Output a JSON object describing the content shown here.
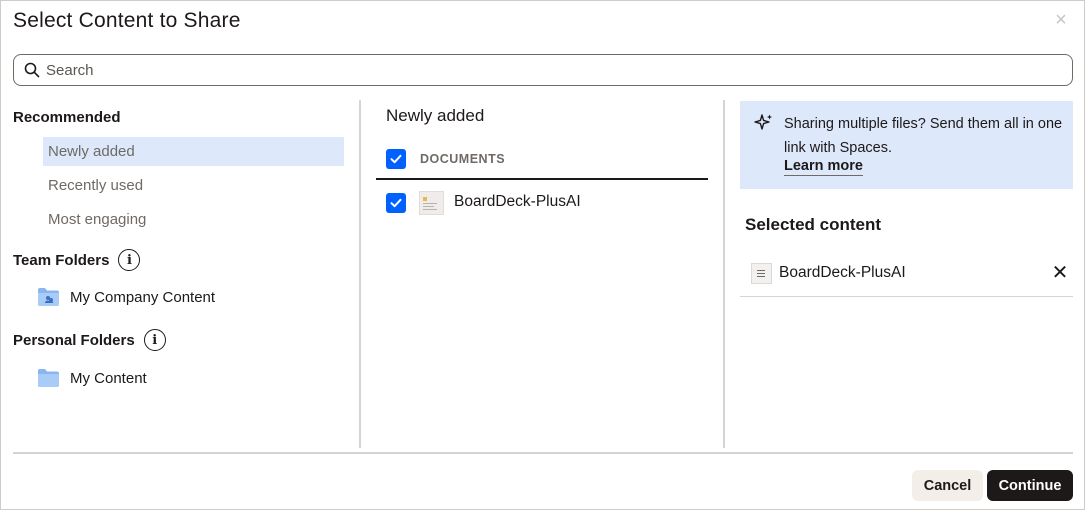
{
  "dialog": {
    "title": "Select Content to Share",
    "close_label": "×"
  },
  "search": {
    "placeholder": "Search"
  },
  "left": {
    "recommended_heading": "Recommended",
    "recommended_items": [
      {
        "label": "Newly added",
        "active": true
      },
      {
        "label": "Recently used",
        "active": false
      },
      {
        "label": "Most engaging",
        "active": false
      }
    ],
    "team_heading": "Team Folders",
    "team_folder": "My Company Content",
    "personal_heading": "Personal Folders",
    "personal_folder": "My Content",
    "info_glyph": "i"
  },
  "middle": {
    "title": "Newly added",
    "documents_heading": "DOCUMENTS",
    "items": [
      {
        "name": "BoardDeck-PlusAI",
        "checked": true
      }
    ]
  },
  "right": {
    "banner_text": "Sharing multiple files? Send them all in one link with Spaces.",
    "banner_link": "Learn more",
    "selected_heading": "Selected content",
    "selected_items": [
      {
        "name": "BoardDeck-PlusAI",
        "remove_label": "✕"
      }
    ]
  },
  "footer": {
    "cancel_label": "Cancel",
    "continue_label": "Continue"
  },
  "colors": {
    "accent": "#0061fe",
    "highlight": "#dde8fb",
    "primary_button": "#1e1919",
    "secondary_button": "#f3eee7"
  },
  "icons": [
    "search-icon",
    "close-icon",
    "info-icon",
    "team-folder-icon",
    "folder-icon",
    "checkbox-checked-icon",
    "sparkle-icon",
    "document-icon",
    "remove-icon"
  ]
}
